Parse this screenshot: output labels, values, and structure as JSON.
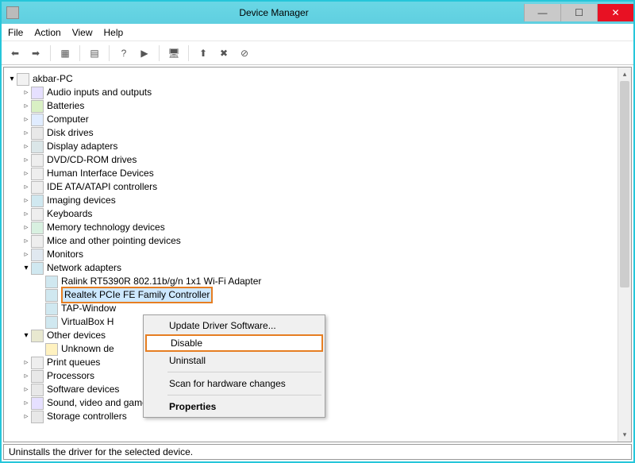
{
  "window": {
    "title": "Device Manager"
  },
  "menu": {
    "file": "File",
    "action": "Action",
    "view": "View",
    "help": "Help"
  },
  "tree": {
    "root": "akbar-PC",
    "items": [
      "Audio inputs and outputs",
      "Batteries",
      "Computer",
      "Disk drives",
      "Display adapters",
      "DVD/CD-ROM drives",
      "Human Interface Devices",
      "IDE ATA/ATAPI controllers",
      "Imaging devices",
      "Keyboards",
      "Memory technology devices",
      "Mice and other pointing devices",
      "Monitors",
      "Network adapters",
      "Other devices",
      "Print queues",
      "Processors",
      "Software devices",
      "Sound, video and game controllers",
      "Storage controllers"
    ],
    "network_children": [
      "Ralink RT5390R 802.11b/g/n 1x1 Wi-Fi Adapter",
      "Realtek PCIe FE Family Controller",
      "TAP-Window",
      "VirtualBox H"
    ],
    "other_children": [
      "Unknown de"
    ]
  },
  "context_menu": {
    "update": "Update Driver Software...",
    "disable": "Disable",
    "uninstall": "Uninstall",
    "scan": "Scan for hardware changes",
    "properties": "Properties"
  },
  "status": "Uninstalls the driver for the selected device."
}
